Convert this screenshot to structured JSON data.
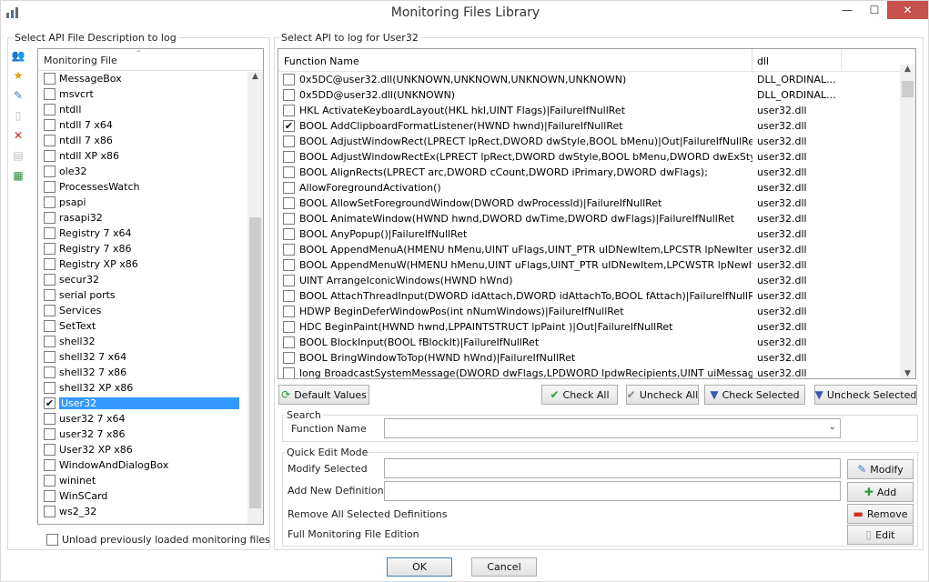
{
  "window": {
    "title": "Monitoring Files Library",
    "minimize": "—",
    "maximize": "☐",
    "close": "✕"
  },
  "left_group": {
    "label": "Select API File Description to log",
    "column_header": "Monitoring File",
    "items": [
      {
        "label": "MessageBox",
        "checked": false
      },
      {
        "label": "msvcrt",
        "checked": false
      },
      {
        "label": "ntdll",
        "checked": false
      },
      {
        "label": "ntdll 7 x64",
        "checked": false
      },
      {
        "label": "ntdll 7 x86",
        "checked": false
      },
      {
        "label": "ntdll XP x86",
        "checked": false
      },
      {
        "label": "ole32",
        "checked": false
      },
      {
        "label": "ProcessesWatch",
        "checked": false
      },
      {
        "label": "psapi",
        "checked": false
      },
      {
        "label": "rasapi32",
        "checked": false
      },
      {
        "label": "Registry 7 x64",
        "checked": false
      },
      {
        "label": "Registry 7 x86",
        "checked": false
      },
      {
        "label": "Registry XP x86",
        "checked": false
      },
      {
        "label": "secur32",
        "checked": false
      },
      {
        "label": "serial ports",
        "checked": false
      },
      {
        "label": "Services",
        "checked": false
      },
      {
        "label": "SetText",
        "checked": false
      },
      {
        "label": "shell32",
        "checked": false
      },
      {
        "label": "shell32 7 x64",
        "checked": false
      },
      {
        "label": "shell32 7 x86",
        "checked": false
      },
      {
        "label": "shell32 XP x86",
        "checked": false
      },
      {
        "label": "User32",
        "checked": true,
        "selected": true
      },
      {
        "label": "user32 7 x64",
        "checked": false
      },
      {
        "label": "user32 7 x86",
        "checked": false
      },
      {
        "label": "User32 XP x86",
        "checked": false
      },
      {
        "label": "WindowAndDialogBox",
        "checked": false
      },
      {
        "label": "wininet",
        "checked": false
      },
      {
        "label": "WinSCard",
        "checked": false
      },
      {
        "label": "ws2_32",
        "checked": false
      }
    ],
    "unload_label": "Unload previously loaded monitoring files"
  },
  "right_group": {
    "label": "Select API to log for User32",
    "columns": {
      "function": "Function Name",
      "dll": "dll"
    },
    "rows": [
      {
        "fn": "0x5DC@user32.dll(UNKNOWN,UNKNOWN,UNKNOWN,UNKNOWN)",
        "dll": "DLL_ORDINAL...",
        "checked": false
      },
      {
        "fn": "0x5DD@user32.dll(UNKNOWN)",
        "dll": "DLL_ORDINAL...",
        "checked": false
      },
      {
        "fn": "HKL ActivateKeyboardLayout(HKL hkl,UINT Flags)|FailureIfNullRet",
        "dll": "user32.dll",
        "checked": false
      },
      {
        "fn": "BOOL AddClipboardFormatListener(HWND hwnd)|FailureIfNullRet",
        "dll": "user32.dll",
        "checked": true
      },
      {
        "fn": "BOOL AdjustWindowRect(LPRECT lpRect,DWORD dwStyle,BOOL bMenu)|Out|FailureIfNullRet",
        "dll": "user32.dll",
        "checked": false
      },
      {
        "fn": "BOOL AdjustWindowRectEx(LPRECT lpRect,DWORD dwStyle,BOOL bMenu,DWORD dwExStyle)|Out|...",
        "dll": "user32.dll",
        "checked": false
      },
      {
        "fn": "BOOL AlignRects(LPRECT arc,DWORD cCount,DWORD iPrimary,DWORD dwFlags);",
        "dll": "user32.dll",
        "checked": false
      },
      {
        "fn": "AllowForegroundActivation()",
        "dll": "user32.dll",
        "checked": false
      },
      {
        "fn": "BOOL AllowSetForegroundWindow(DWORD dwProcessId)|FailureIfNullRet",
        "dll": "user32.dll",
        "checked": false
      },
      {
        "fn": "BOOL AnimateWindow(HWND hwnd,DWORD dwTime,DWORD dwFlags)|FailureIfNullRet",
        "dll": "user32.dll",
        "checked": false
      },
      {
        "fn": "BOOL AnyPopup()|FailureIfNullRet",
        "dll": "user32.dll",
        "checked": false
      },
      {
        "fn": "BOOL AppendMenuA(HMENU hMenu,UINT uFlags,UINT_PTR uIDNewItem,LPCSTR lpNewItem)|Failur...",
        "dll": "user32.dll",
        "checked": false
      },
      {
        "fn": "BOOL AppendMenuW(HMENU hMenu,UINT uFlags,UINT_PTR uIDNewItem,LPCWSTR lpNewItem)|Fail...",
        "dll": "user32.dll",
        "checked": false
      },
      {
        "fn": "UINT ArrangeIconicWindows(HWND hWnd)",
        "dll": "user32.dll",
        "checked": false
      },
      {
        "fn": "BOOL AttachThreadInput(DWORD idAttach,DWORD idAttachTo,BOOL fAttach)|FailureIfNullRet",
        "dll": "user32.dll",
        "checked": false
      },
      {
        "fn": "HDWP BeginDeferWindowPos(int nNumWindows)|FailureIfNullRet",
        "dll": "user32.dll",
        "checked": false
      },
      {
        "fn": "HDC BeginPaint(HWND hwnd,LPPAINTSTRUCT lpPaint )|Out|FailureIfNullRet",
        "dll": "user32.dll",
        "checked": false
      },
      {
        "fn": "BOOL BlockInput(BOOL fBlockIt)|FailureIfNullRet",
        "dll": "user32.dll",
        "checked": false
      },
      {
        "fn": "BOOL BringWindowToTop(HWND hWnd)|FailureIfNullRet",
        "dll": "user32.dll",
        "checked": false
      },
      {
        "fn": "long BroadcastSystemMessage(DWORD dwFlags,LPDWORD lpdwRecipients,UINT uiMessage,WPARA...",
        "dll": "user32.dll",
        "checked": false
      }
    ]
  },
  "buttons": {
    "default_values": "Default Values",
    "check_all": "Check All",
    "uncheck_all": "Uncheck All",
    "check_selected": "Check Selected",
    "uncheck_selected": "Uncheck Selected",
    "modify": "Modify",
    "add": "Add",
    "remove": "Remove",
    "edit": "Edit",
    "ok": "OK",
    "cancel": "Cancel"
  },
  "search": {
    "label": "Search",
    "function_name_label": "Function Name",
    "value": ""
  },
  "quick_edit": {
    "label": "Quick Edit Mode",
    "modify_selected": "Modify Selected",
    "add_new_definition": "Add New Definition",
    "remove_all_selected": "Remove All Selected Definitions",
    "full_edition": "Full Monitoring File Edition",
    "modify_value": "",
    "add_value": ""
  },
  "colors": {
    "selection": "#3399ff",
    "close_button": "#c7514c"
  }
}
